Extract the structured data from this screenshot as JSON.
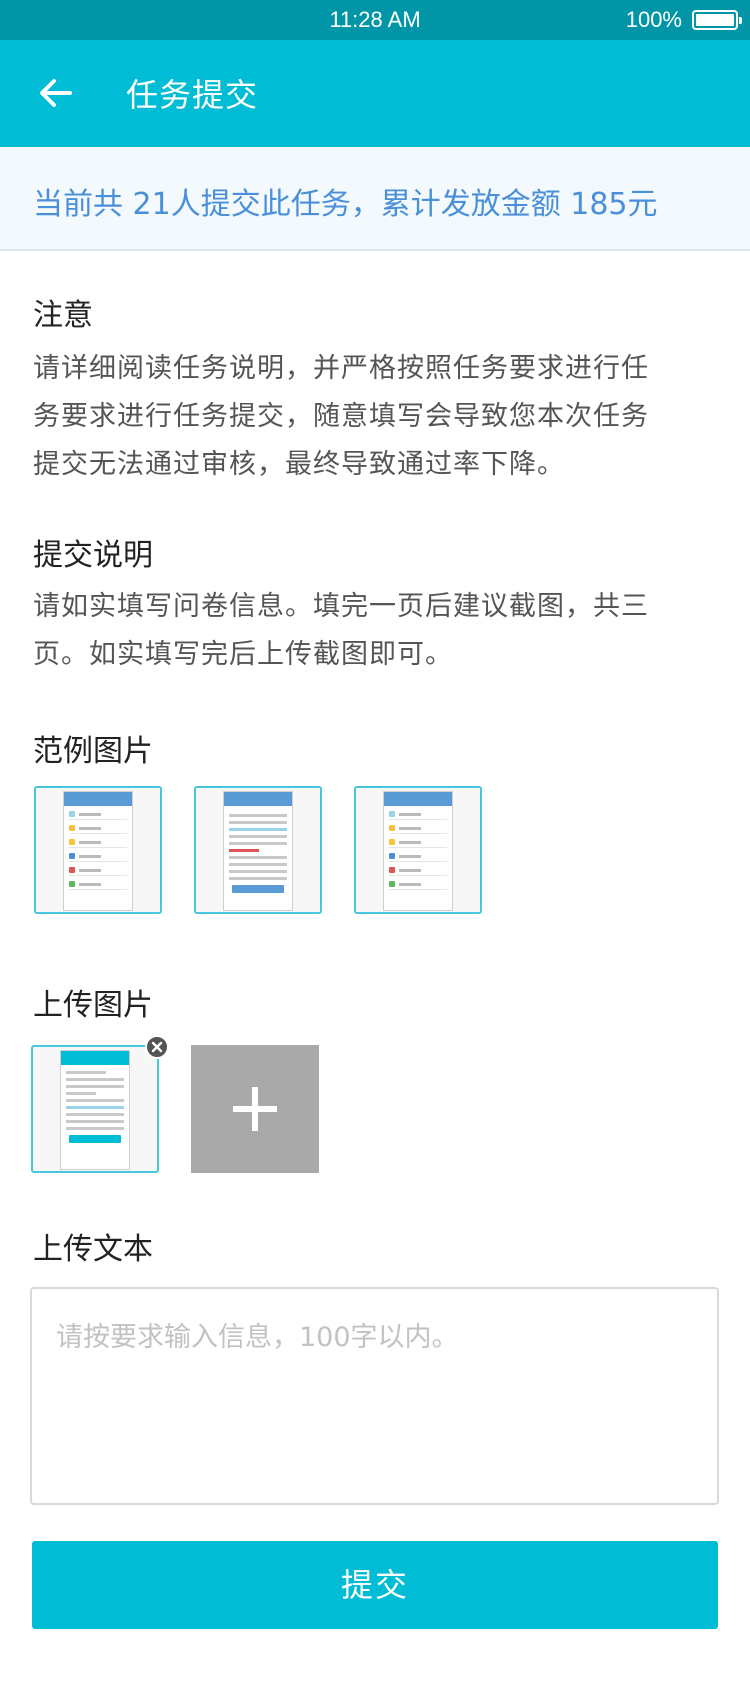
{
  "status": {
    "time": "11:28 AM",
    "battery": "100%"
  },
  "nav": {
    "title": "任务提交"
  },
  "banner": {
    "text": "当前共 21人提交此任务，累计发放金额 185元"
  },
  "notice": {
    "title": "注意",
    "lines": [
      "请详细阅读任务说明，并严格按照任务要求进行任",
      "务要求进行任务提交，随意填写会导致您本次任务",
      "提交无法通过审核，最终导致通过率下降。"
    ]
  },
  "instructions": {
    "title": "提交说明",
    "lines": [
      "请如实填写问卷信息。填完一页后建议截图，共三",
      "页。如实填写完后上传截图即可。"
    ]
  },
  "examples": {
    "title": "范例图片"
  },
  "upload_images": {
    "title": "上传图片",
    "add_symbol": "+"
  },
  "upload_text": {
    "title": "上传文本",
    "placeholder": "请按要求输入信息，100字以内。"
  },
  "submit": {
    "label": "提交"
  },
  "colors": {
    "primary": "#00bcd4",
    "status_bar": "#0096a8",
    "banner_text": "#4a90d9"
  }
}
